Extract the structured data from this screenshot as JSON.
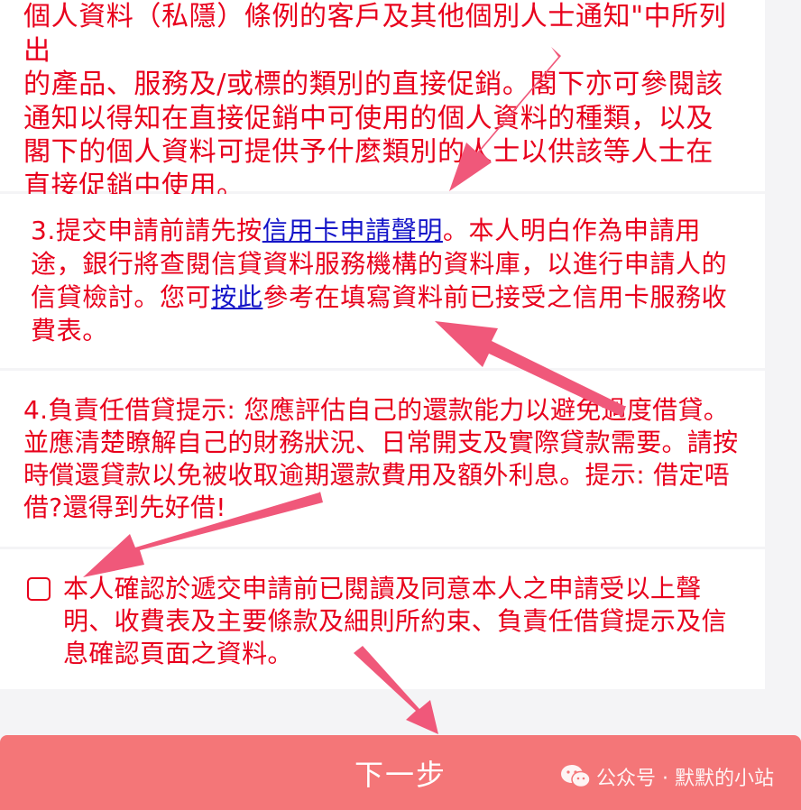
{
  "section1": {
    "lines": [
      "個人資料（私隱）條例的客戶及其他個別人士通知\"中所列出",
      "的產品、服務及/或標的類別的直接促銷。閣下亦可參閱該",
      "通知以得知在直接促銷中可使用的個人資料的種類，以及",
      "閣下的個人資料可提供予什麼類別的人士以供該等人士在",
      "直接促銷中使用。"
    ]
  },
  "section2": {
    "prefix": "3.提交申請前請先按",
    "link1": "信用卡申請聲明",
    "middle": "。本人明白作為申請用途，銀行將查閱信貸資料服務機構的資料庫，以進行申請人的信貸檢討。您可",
    "link2": "按此",
    "suffix": "參考在填寫資料前已接受之信用卡服務收費表。"
  },
  "section3": {
    "text": "4.負責任借貸提示: 您應評估自己的還款能力以避免過度借貸。並應清楚瞭解自己的財務狀況、日常開支及實際貸款需要。請按時償還貸款以免被收取逾期還款費用及額外利息。提示: 借定唔借?還得到先好借!"
  },
  "confirm": {
    "checked": false,
    "text": "本人確認於遞交申請前已閱讀及同意本人之申請受以上聲明、收費表及主要條款及細則所約束、負責任借貸提示及信息確認頁面之資料。"
  },
  "next_button": {
    "label": "下一步"
  },
  "watermark": {
    "icon": "wechat-icon",
    "text": "公众号 · 默默的小站"
  },
  "colors": {
    "text_red": "#e8001c",
    "link_blue": "#1414c8",
    "button_bg": "#f47678",
    "arrow": "#f0587a"
  }
}
